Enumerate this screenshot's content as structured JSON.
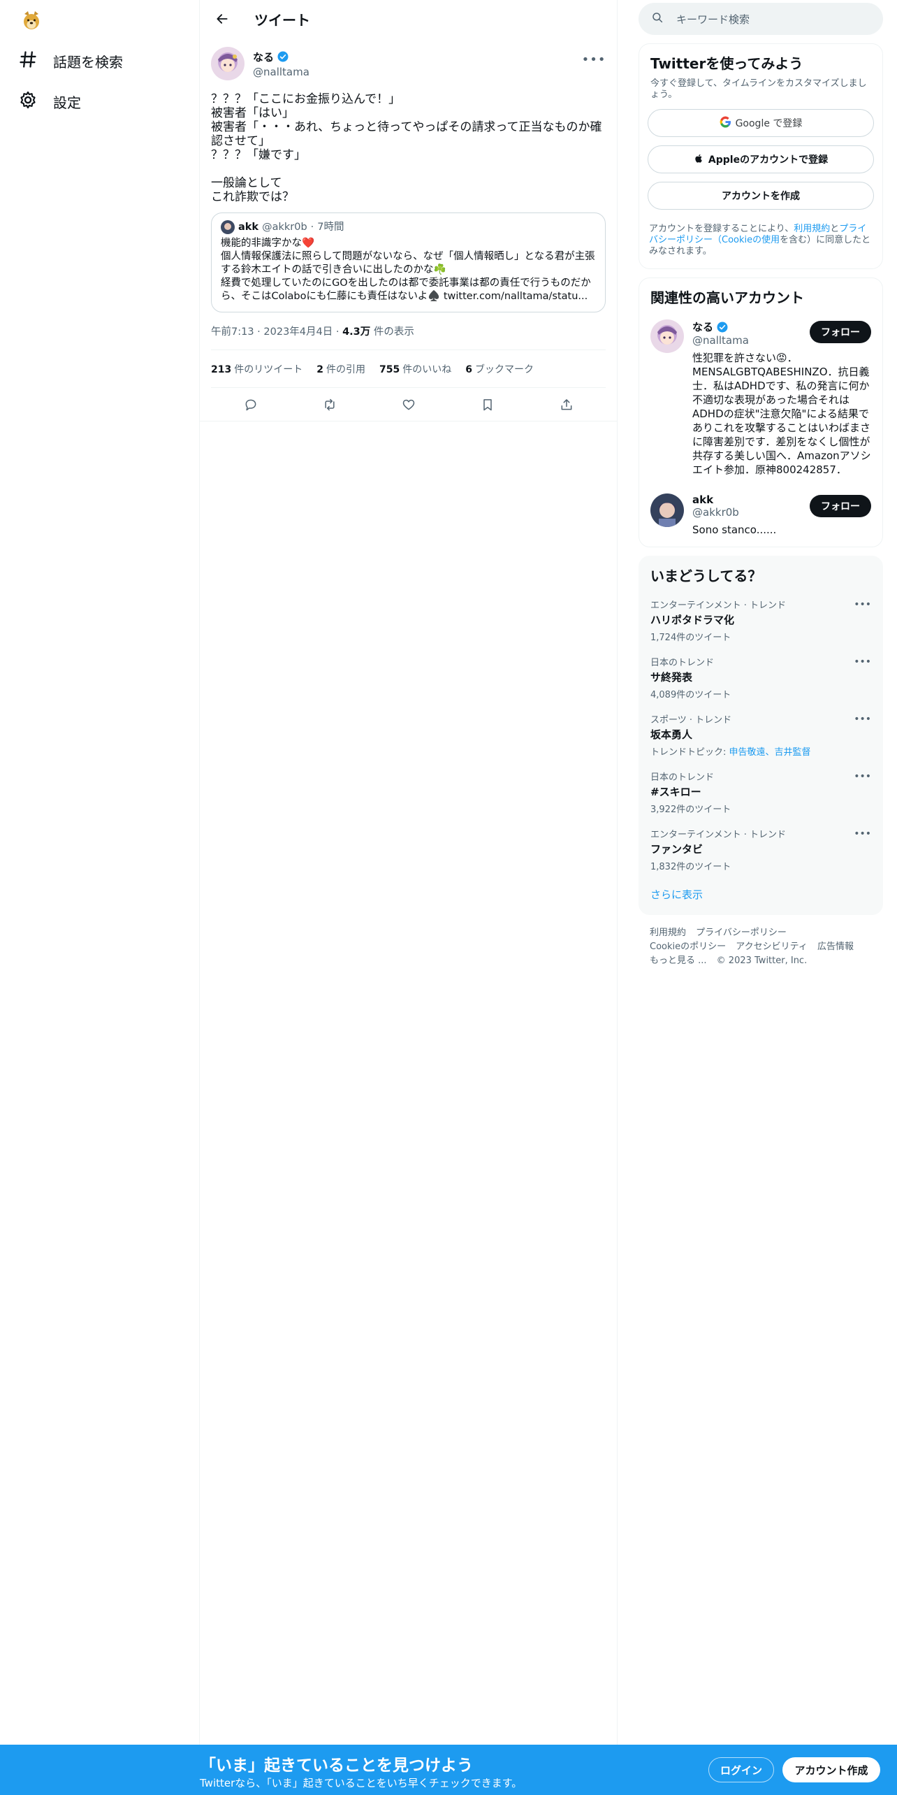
{
  "nav": {
    "explore_label": "話題を検索",
    "settings_label": "設定"
  },
  "header": {
    "title": "ツイート"
  },
  "tweet": {
    "author_name": "なる",
    "author_handle": "@nalltama",
    "text": "？？？「ここにお金振り込んで！」\n被害者「はい」\n被害者「・・・あれ、ちょっと待ってやっぱその請求って正当なものか確認させて」\n？？？「嫌です」\n\n一般論として\nこれ詐欺では？",
    "time": "午前7:13",
    "date": "2023年4月4日",
    "views_value": "4.3万",
    "views_label": "件の表示",
    "separator": "·",
    "quote": {
      "name": "akk",
      "handle": "@akkr0b",
      "time": "7時間",
      "text_1": "機能的非識字かな❤️",
      "text_2": "個人情報保護法に照らして問題がないなら、なぜ「個人情報晒し」となる君が主張する鈴木エイトの話で引き合いに出したのかな☘️",
      "text_3": "経費で処理していたのにGOを出したのは都で委託事業は都の責任で行うものだから、そこはColaboにも仁藤にも責任はないよ♠️ twitter.com/nalltama/statu..."
    },
    "stats": {
      "retweets": "213",
      "retweets_label": "件のリツイート",
      "quotes": "2",
      "quotes_label": "件の引用",
      "likes": "755",
      "likes_label": "件のいいね",
      "bookmarks": "6",
      "bookmarks_label": "ブックマーク"
    }
  },
  "search": {
    "placeholder": "キーワード検索"
  },
  "signup": {
    "title": "Twitterを使ってみよう",
    "subtitle": "今すぐ登録して、タイムラインをカスタマイズしましょう。",
    "google_label": "Google で登録",
    "apple_label": "Appleのアカウントで登録",
    "create_label": "アカウントを作成",
    "terms_prefix": "アカウントを登録することにより、",
    "terms_link": "利用規約",
    "terms_and": "と",
    "privacy_link": "プライバシーポリシー",
    "cookie_link": "（Cookieの使用",
    "terms_suffix": "を含む）に同意したとみなされます。"
  },
  "relevant": {
    "title": "関連性の高いアカウント",
    "follow_label": "フォロー",
    "accounts": [
      {
        "name": "なる",
        "handle": "@nalltama",
        "bio": "性犯罪を許さない😡．MENSALGBTQABESHINZO．抗日義士．私はADHDです、私の発言に何か不適切な表現があった場合それはADHDの症状\"注意欠陥\"による結果でありこれを攻撃することはいわばまさに障害差別です．差別をなくし個性が共存する美しい国へ．Amazonアソシエイト参加．原神800242857．"
      },
      {
        "name": "akk",
        "handle": "@akkr0b",
        "bio": "Sono stanco......"
      }
    ]
  },
  "trends": {
    "title": "いまどうしてる？",
    "items": [
      {
        "category": "エンターテインメント · トレンド",
        "title": "ハリポタドラマ化",
        "count": "1,724件のツイート"
      },
      {
        "category": "日本のトレンド",
        "title": "サ終発表",
        "count": "4,089件のツイート"
      },
      {
        "category": "スポーツ · トレンド",
        "title": "坂本勇人",
        "count_prefix": "トレンドトピック: ",
        "count_link": "申告敬遠、吉井監督"
      },
      {
        "category": "日本のトレンド",
        "title": "#スキロー",
        "count": "3,922件のツイート"
      },
      {
        "category": "エンターテインメント · トレンド",
        "title": "ファンタビ",
        "count": "1,832件のツイート"
      }
    ],
    "show_more": "さらに表示"
  },
  "footer": {
    "links": [
      "利用規約",
      "プライバシーポリシー",
      "Cookieのポリシー",
      "アクセシビリティ",
      "広告情報",
      "もっと見る ..."
    ],
    "copyright": "© 2023 Twitter, Inc."
  },
  "banner": {
    "title": "「いま」起きていることを見つけよう",
    "subtitle": "Twitterなら、「いま」起きていることをいち早くチェックできます。",
    "login_label": "ログイン",
    "create_label": "アカウント作成"
  },
  "colors": {
    "accent": "#1d9bf0",
    "text": "#0f1419",
    "muted": "#536471"
  }
}
